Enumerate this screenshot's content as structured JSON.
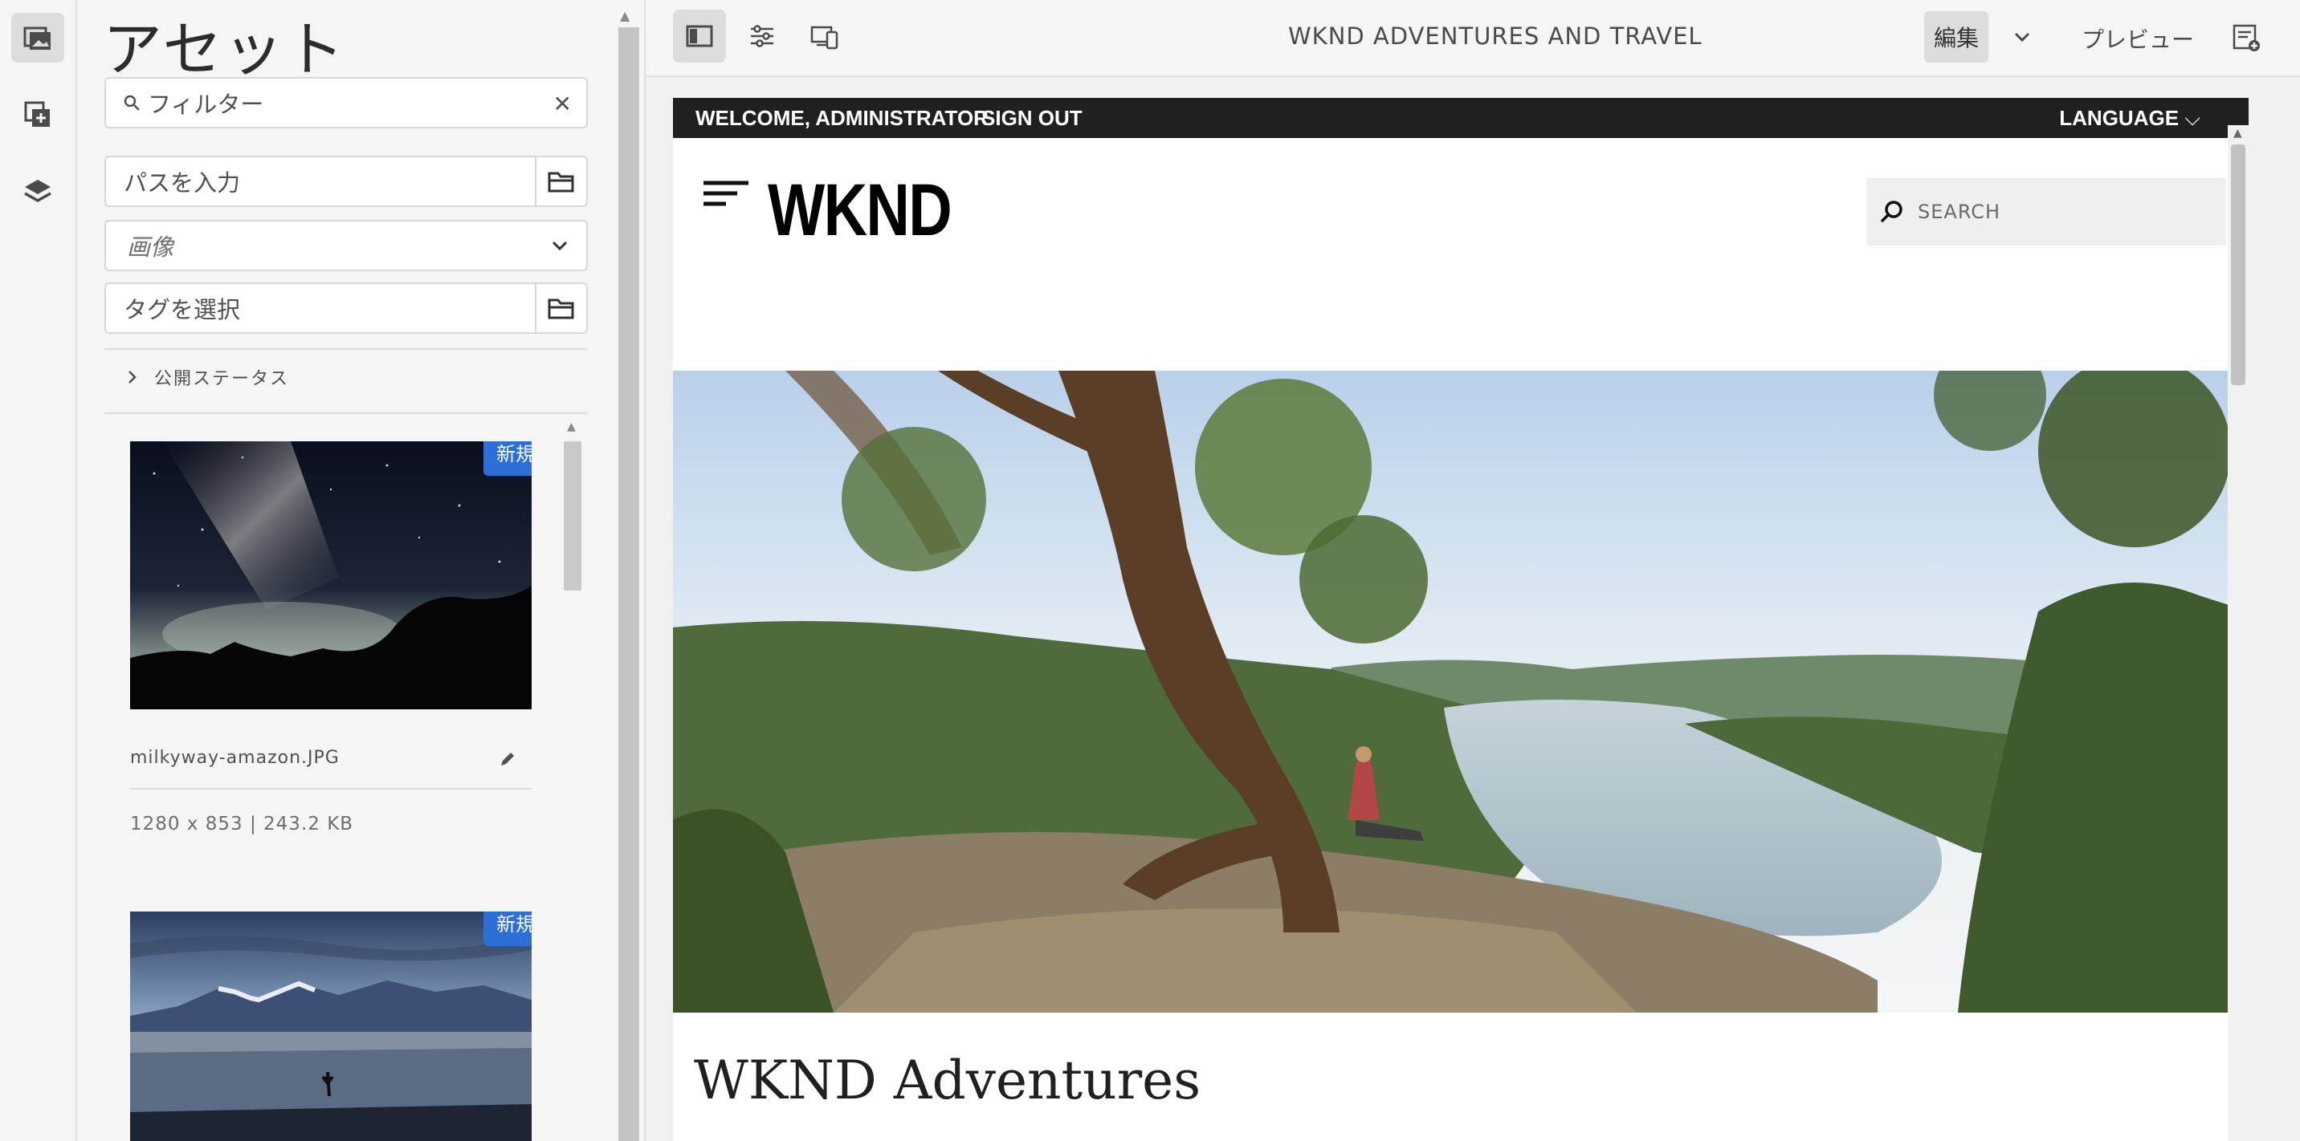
{
  "rail": {
    "items": [
      {
        "name": "assets",
        "icon": "assets-icon"
      },
      {
        "name": "components",
        "icon": "components-icon"
      },
      {
        "name": "content-tree",
        "icon": "layers-icon"
      }
    ]
  },
  "panel": {
    "title": "アセット",
    "filter_placeholder": "フィルター",
    "path_placeholder": "パスを入力",
    "type_value": "画像",
    "tags_placeholder": "タグを選択",
    "publish_status_label": "公開ステータス",
    "assets": [
      {
        "name": "milkyway-amazon.JPG",
        "meta": "1280 x 853 | 243.2 KB",
        "badge": "新規"
      },
      {
        "name": "",
        "meta": "",
        "badge": "新規"
      }
    ]
  },
  "toolbar": {
    "title": "WKND ADVENTURES AND TRAVEL",
    "edit_label": "編集",
    "preview_label": "プレビュー"
  },
  "site": {
    "welcome": "WELCOME, ADMINISTRATOR",
    "sign_out": "SIGN OUT",
    "language": "LANGUAGE",
    "logo": "WKND",
    "search_placeholder": "SEARCH",
    "page_title": "WKND Adventures"
  },
  "colors": {
    "accent": "#2d6fd6",
    "site_topbar": "#202020"
  }
}
